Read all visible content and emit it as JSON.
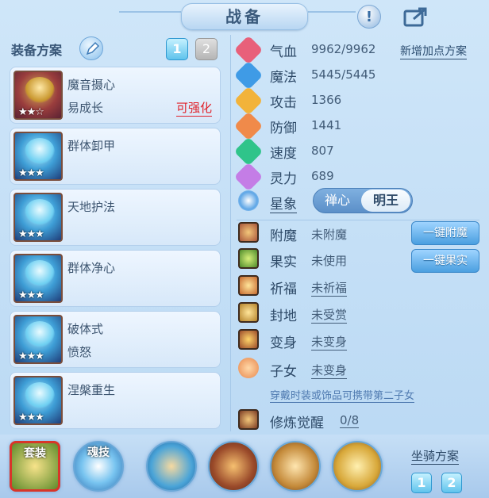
{
  "header": {
    "title": "战备"
  },
  "equipment": {
    "plan_label": "装备方案",
    "plans": [
      "1",
      "2"
    ],
    "cards": [
      {
        "name": "魔音摄心",
        "sub": "易成长",
        "tag": "可强化",
        "stars": "★★☆",
        "icon": "skill-icon-demon-voice"
      },
      {
        "name": "群体卸甲",
        "sub": "",
        "tag": "",
        "stars": "★★★",
        "icon": "skill-icon-group-disarm"
      },
      {
        "name": "天地护法",
        "sub": "",
        "tag": "",
        "stars": "★★★",
        "icon": "skill-icon-heaven-guard"
      },
      {
        "name": "群体净心",
        "sub": "",
        "tag": "",
        "stars": "★★★",
        "icon": "skill-icon-group-purify"
      },
      {
        "name": "破体式",
        "sub": "愤怒",
        "tag": "",
        "stars": "★★★",
        "icon": "skill-icon-break-body"
      },
      {
        "name": "涅槃重生",
        "sub": "",
        "tag": "",
        "stars": "★★★",
        "icon": "skill-icon-nirvana"
      }
    ]
  },
  "stats": {
    "add_plan": "新增加点方案",
    "items": [
      {
        "label": "气血",
        "value": "9962/9962",
        "color": "#e8607a"
      },
      {
        "label": "魔法",
        "value": "5445/5445",
        "color": "#3f9be6"
      },
      {
        "label": "攻击",
        "value": "1366",
        "color": "#f2b33a"
      },
      {
        "label": "防御",
        "value": "1441",
        "color": "#f08a4a"
      },
      {
        "label": "速度",
        "value": "807",
        "color": "#2fc48a"
      },
      {
        "label": "灵力",
        "value": "689",
        "color": "#c47de6"
      }
    ],
    "star_sign": {
      "label": "星象",
      "options": [
        "禅心",
        "明王"
      ],
      "selected": "明王"
    }
  },
  "extras": {
    "items": [
      {
        "label": "附魔",
        "value": "未附魔"
      },
      {
        "label": "果实",
        "value": "未使用"
      },
      {
        "label": "祈福",
        "value": "未祈福"
      },
      {
        "label": "封地",
        "value": "未受赏"
      },
      {
        "label": "变身",
        "value": "未变身"
      },
      {
        "label": "子女",
        "value": "未变身"
      }
    ],
    "btn_enchant": "一键附魔",
    "btn_fruit": "一键果实",
    "note": "穿戴时装或饰品可携带第二子女",
    "cultivation": {
      "label": "修炼觉醒",
      "value": "0/8"
    }
  },
  "bottom": {
    "set_label": "套装",
    "soul_label": "魂技",
    "mount_label": "坐骑方案",
    "mount_plans": [
      "1",
      "2"
    ]
  }
}
